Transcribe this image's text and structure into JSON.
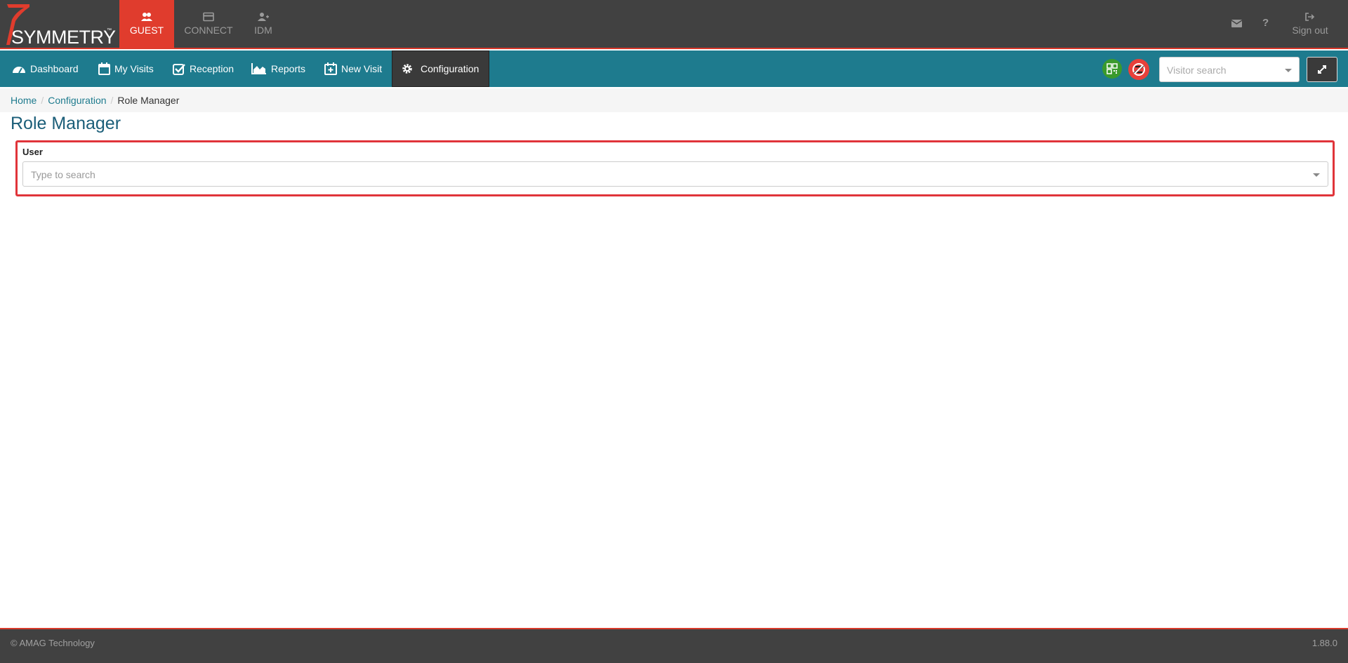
{
  "brand": {
    "logo_text": "SYMMETRY",
    "tm": "™"
  },
  "modules": [
    {
      "label": "GUEST",
      "icon": "users-icon",
      "active": true
    },
    {
      "label": "CONNECT",
      "icon": "card-icon",
      "active": false
    },
    {
      "label": "IDM",
      "icon": "user-plus-icon",
      "active": false
    }
  ],
  "top_right": {
    "mail_icon": "envelope-icon",
    "help_icon": "?",
    "signout_label": "Sign out"
  },
  "nav": {
    "items": [
      {
        "label": "Dashboard",
        "icon": "dashboard-icon"
      },
      {
        "label": "My Visits",
        "icon": "calendar-icon"
      },
      {
        "label": "Reception",
        "icon": "check-square-icon"
      },
      {
        "label": "Reports",
        "icon": "area-chart-icon"
      },
      {
        "label": "New Visit",
        "icon": "calendar-plus-icon"
      },
      {
        "label": "Configuration",
        "icon": "gear-icon",
        "active": true
      }
    ],
    "visitor_search_placeholder": "Visitor search"
  },
  "breadcrumb": {
    "home": "Home",
    "configuration": "Configuration",
    "current": "Role Manager",
    "separator": "/"
  },
  "page": {
    "title": "Role Manager"
  },
  "user_panel": {
    "label": "User",
    "placeholder": "Type to search"
  },
  "footer": {
    "copyright": "© AMAG Technology",
    "version": "1.88.0"
  },
  "colors": {
    "accent_red": "#e03c2d",
    "nav_teal": "#1e7b8e",
    "dark_bar": "#414141",
    "title_blue": "#1b5e79",
    "highlight_border": "#e0343a"
  }
}
